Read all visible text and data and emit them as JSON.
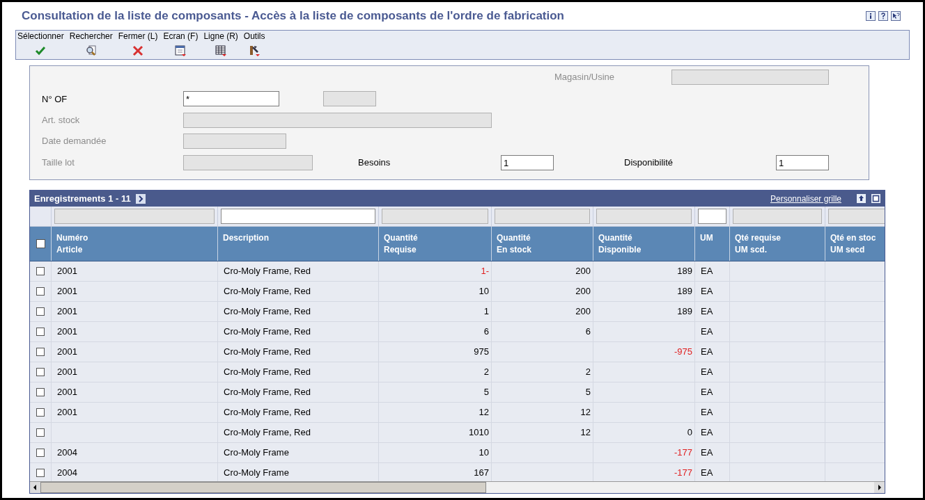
{
  "window": {
    "title": "Consultation de la liste de composants - Accès à la liste de composants de l'ordre de fabrication"
  },
  "toolbar": [
    {
      "label": "Sélectionner"
    },
    {
      "label": "Rechercher"
    },
    {
      "label": "Fermer (L)"
    },
    {
      "label": "Ecran (F)"
    },
    {
      "label": "Ligne (R)"
    },
    {
      "label": "Outils"
    }
  ],
  "form": {
    "warehouse": {
      "label": "Magasin/Usine",
      "disabled": true,
      "value_editable": false
    },
    "order_number": {
      "label": "N° OF",
      "disabled": false,
      "value": "*",
      "value_editable": true
    },
    "item": {
      "label": "Art. stock",
      "disabled": true
    },
    "requested_date": {
      "label": "Date demandée",
      "disabled": true
    },
    "lot_size": {
      "label": "Taille lot",
      "disabled": true
    },
    "needs": {
      "label": "Besoins",
      "value": "1"
    },
    "availability": {
      "label": "Disponibilité",
      "value": "1"
    }
  },
  "grid": {
    "title": "Enregistrements 1 - 11",
    "customize_link": "Personnaliser grille",
    "select_all_checked": false,
    "columns": [
      {
        "label": "Numéro\nArticle",
        "filter_editable": false
      },
      {
        "label": "Description",
        "filter_editable": true
      },
      {
        "label": "Quantité\nRequise",
        "filter_editable": false
      },
      {
        "label": "Quantité\nEn stock",
        "filter_editable": false
      },
      {
        "label": "Quantité\nDisponible",
        "filter_editable": false
      },
      {
        "label": "UM",
        "filter_editable": true
      },
      {
        "label": "Qté requise\nUM scd.",
        "filter_editable": false
      },
      {
        "label": "Qté en stoc\nUM secd",
        "filter_editable": false
      }
    ],
    "rows": [
      {
        "checked": false,
        "cells": [
          {
            "text": "2001"
          },
          {
            "text": "Cro-Moly Frame, Red"
          },
          {
            "text": "1-",
            "negative": true
          },
          {
            "text": "200"
          },
          {
            "text": "189"
          },
          {
            "text": "EA"
          }
        ]
      },
      {
        "checked": false,
        "cells": [
          {
            "text": "2001"
          },
          {
            "text": "Cro-Moly Frame, Red"
          },
          {
            "text": "10"
          },
          {
            "text": "200"
          },
          {
            "text": "189"
          },
          {
            "text": "EA"
          }
        ]
      },
      {
        "checked": false,
        "cells": [
          {
            "text": "2001"
          },
          {
            "text": "Cro-Moly Frame, Red"
          },
          {
            "text": "1"
          },
          {
            "text": "200"
          },
          {
            "text": "189"
          },
          {
            "text": "EA"
          }
        ]
      },
      {
        "checked": false,
        "cells": [
          {
            "text": "2001"
          },
          {
            "text": "Cro-Moly Frame, Red"
          },
          {
            "text": "6"
          },
          {
            "text": "6"
          },
          {
            "text": ""
          },
          {
            "text": "EA"
          }
        ]
      },
      {
        "checked": false,
        "cells": [
          {
            "text": "2001"
          },
          {
            "text": "Cro-Moly Frame, Red"
          },
          {
            "text": "975"
          },
          {
            "text": ""
          },
          {
            "text": "-975",
            "negative": true
          },
          {
            "text": "EA"
          }
        ]
      },
      {
        "checked": false,
        "cells": [
          {
            "text": "2001"
          },
          {
            "text": "Cro-Moly Frame, Red"
          },
          {
            "text": "2"
          },
          {
            "text": "2"
          },
          {
            "text": ""
          },
          {
            "text": "EA"
          }
        ]
      },
      {
        "checked": false,
        "cells": [
          {
            "text": "2001"
          },
          {
            "text": "Cro-Moly Frame, Red"
          },
          {
            "text": "5"
          },
          {
            "text": "5"
          },
          {
            "text": ""
          },
          {
            "text": "EA"
          }
        ]
      },
      {
        "checked": false,
        "cells": [
          {
            "text": "2001"
          },
          {
            "text": "Cro-Moly Frame, Red"
          },
          {
            "text": "12"
          },
          {
            "text": "12"
          },
          {
            "text": ""
          },
          {
            "text": "EA"
          }
        ]
      },
      {
        "checked": false,
        "cells": [
          {
            "text": ""
          },
          {
            "text": "Cro-Moly Frame, Red"
          },
          {
            "text": "1010"
          },
          {
            "text": "12"
          },
          {
            "text": "0"
          },
          {
            "text": "EA"
          }
        ]
      },
      {
        "checked": false,
        "cells": [
          {
            "text": "2004"
          },
          {
            "text": "Cro-Moly Frame"
          },
          {
            "text": "10"
          },
          {
            "text": ""
          },
          {
            "text": "-177",
            "negative": true
          },
          {
            "text": "EA"
          }
        ]
      },
      {
        "checked": false,
        "cells": [
          {
            "text": "2004"
          },
          {
            "text": "Cro-Moly Frame"
          },
          {
            "text": "167"
          },
          {
            "text": ""
          },
          {
            "text": "-177",
            "negative": true
          },
          {
            "text": "EA"
          }
        ]
      }
    ]
  }
}
